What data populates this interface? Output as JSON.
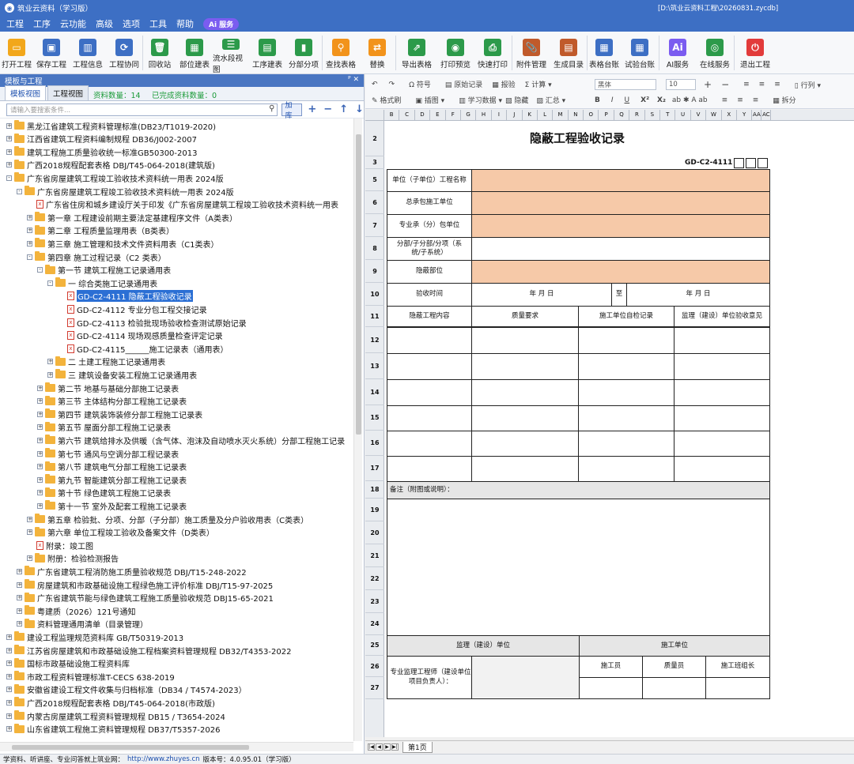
{
  "window": {
    "title": "筑业云资料（学习版）",
    "path": "[D:\\筑业云资料工程\\20260831.zycdb]"
  },
  "menu": {
    "items": [
      "工程",
      "工序",
      "云功能",
      "高级",
      "选项",
      "工具",
      "帮助"
    ],
    "ai_badge": "Ai 服务"
  },
  "toolbar": [
    {
      "label": "打开工程",
      "icon": "folder-open-icon",
      "color": "#f2a71b"
    },
    {
      "label": "保存工程",
      "icon": "save-icon",
      "color": "#3d6fc4"
    },
    {
      "label": "工程信息",
      "icon": "building-info-icon",
      "color": "#3d6fc4"
    },
    {
      "label": "工程协同",
      "icon": "sync-icon",
      "color": "#3d6fc4"
    },
    {
      "label": "回收站",
      "icon": "recycle-bin-icon",
      "color": "#2c9a4a"
    },
    {
      "label": "部位建表",
      "icon": "table-part-icon",
      "color": "#2c9a4a"
    },
    {
      "label": "流水段视图",
      "icon": "flow-view-icon",
      "color": "#2c9a4a"
    },
    {
      "label": "工序建表",
      "icon": "process-table-icon",
      "color": "#2c9a4a"
    },
    {
      "label": "分部分项",
      "icon": "chart-icon",
      "color": "#2c9a4a"
    },
    {
      "label": "查找表格",
      "icon": "search-icon",
      "color": "#f2931b"
    },
    {
      "label": "替换",
      "icon": "replace-icon",
      "color": "#f2931b"
    },
    {
      "label": "导出表格",
      "icon": "export-icon",
      "color": "#2c9a4a"
    },
    {
      "label": "打印预览",
      "icon": "eye-icon",
      "color": "#2c9a4a"
    },
    {
      "label": "快速打印",
      "icon": "printer-icon",
      "color": "#2c9a4a"
    },
    {
      "label": "附件管理",
      "icon": "attachment-icon",
      "color": "#c05a2b"
    },
    {
      "label": "生成目录",
      "icon": "catalog-icon",
      "color": "#c05a2b"
    },
    {
      "label": "表格台账",
      "icon": "ledger-icon",
      "color": "#3d6fc4"
    },
    {
      "label": "试验台账",
      "icon": "test-ledger-icon",
      "color": "#3d6fc4"
    },
    {
      "label": "AI服务",
      "icon": "ai-icon",
      "color": "#7b5cf0"
    },
    {
      "label": "在线服务",
      "icon": "online-service-icon",
      "color": "#2c9a4a"
    },
    {
      "label": "退出工程",
      "icon": "power-icon",
      "color": "#e23b3b"
    }
  ],
  "left_panel": {
    "title": "模板与工程",
    "tabs": [
      "模板视图",
      "工程视图"
    ],
    "stats": {
      "count_label": "资料数量：14",
      "done_label": "已完成资料数量：0"
    },
    "search": {
      "placeholder": "请输入要搜索条件...",
      "button": "加库"
    },
    "tree": [
      {
        "d": 0,
        "t": "f",
        "e": "+",
        "x": "黑龙江省建筑工程资料管理标准(DB23/T1019-2020)"
      },
      {
        "d": 0,
        "t": "f",
        "e": "+",
        "x": "江西省建筑工程资料编制规程 DB36/J002-2007"
      },
      {
        "d": 0,
        "t": "f",
        "e": "+",
        "x": "建筑工程施工质量验收统一标准GB50300-2013"
      },
      {
        "d": 0,
        "t": "f",
        "e": "+",
        "x": "广西2018规程配套表格 DBJ/T45-064-2018(建筑版)"
      },
      {
        "d": 0,
        "t": "f",
        "e": "-",
        "x": "广东省房屋建筑工程竣工验收技术资料统一用表 2024版"
      },
      {
        "d": 1,
        "t": "f",
        "e": "-",
        "x": "广东省房屋建筑工程竣工验收技术资料统一用表 2024版"
      },
      {
        "d": 2,
        "t": "d",
        "e": "",
        "x": "广东省住房和城乡建设厅关于印发《广东省房屋建筑工程竣工验收技术资料统一用表"
      },
      {
        "d": 2,
        "t": "f",
        "e": "+",
        "x": "第一章 工程建设前期主要法定基建程序文件（A类表）"
      },
      {
        "d": 2,
        "t": "f",
        "e": "+",
        "x": "第二章 工程质量监理用表（B类表）"
      },
      {
        "d": 2,
        "t": "f",
        "e": "+",
        "x": "第三章 施工管理和技术文件资料用表（C1类表）"
      },
      {
        "d": 2,
        "t": "f",
        "e": "-",
        "x": "第四章 施工过程记录（C2 类表）"
      },
      {
        "d": 3,
        "t": "f",
        "e": "-",
        "x": "第一节 建筑工程施工记录通用表"
      },
      {
        "d": 4,
        "t": "f",
        "e": "-",
        "x": "一 综合类施工记录通用表"
      },
      {
        "d": 5,
        "t": "d",
        "e": "",
        "x": "GD-C2-4111 隐蔽工程验收记录",
        "sel": true
      },
      {
        "d": 5,
        "t": "d",
        "e": "",
        "x": "GD-C2-4112 专业分包工程交接记录"
      },
      {
        "d": 5,
        "t": "d",
        "e": "",
        "x": "GD-C2-4113 检验批现场验收检查测试原始记录"
      },
      {
        "d": 5,
        "t": "d",
        "e": "",
        "x": "GD-C2-4114 现场观感质量检查评定记录"
      },
      {
        "d": 5,
        "t": "d",
        "e": "",
        "x": "GD-C2-4115______施工记录表（通用表）"
      },
      {
        "d": 4,
        "t": "f",
        "e": "+",
        "x": "二 土建工程施工记录通用表"
      },
      {
        "d": 4,
        "t": "f",
        "e": "+",
        "x": "三 建筑设备安装工程施工记录通用表"
      },
      {
        "d": 3,
        "t": "f",
        "e": "+",
        "x": "第二节 地基与基础分部施工记录表"
      },
      {
        "d": 3,
        "t": "f",
        "e": "+",
        "x": "第三节 主体结构分部工程施工记录表"
      },
      {
        "d": 3,
        "t": "f",
        "e": "+",
        "x": "第四节 建筑装饰装修分部工程施工记录表"
      },
      {
        "d": 3,
        "t": "f",
        "e": "+",
        "x": "第五节 屋面分部工程施工记录表"
      },
      {
        "d": 3,
        "t": "f",
        "e": "+",
        "x": "第六节 建筑给排水及供暖（含气体、泡沫及自动喷水灭火系统）分部工程施工记录"
      },
      {
        "d": 3,
        "t": "f",
        "e": "+",
        "x": "第七节 通风与空调分部工程记录表"
      },
      {
        "d": 3,
        "t": "f",
        "e": "+",
        "x": "第八节 建筑电气分部工程施工记录表"
      },
      {
        "d": 3,
        "t": "f",
        "e": "+",
        "x": "第九节 智能建筑分部工程施工记录表"
      },
      {
        "d": 3,
        "t": "f",
        "e": "+",
        "x": "第十节 绿色建筑工程施工记录表"
      },
      {
        "d": 3,
        "t": "f",
        "e": "+",
        "x": "第十一节 室外及配套工程施工记录表"
      },
      {
        "d": 2,
        "t": "f",
        "e": "+",
        "x": "第五章 检验批、分项、分部（子分部）施工质量及分户验收用表（C类表）"
      },
      {
        "d": 2,
        "t": "f",
        "e": "+",
        "x": "第六章 单位工程竣工验收及备案文件（D类表）"
      },
      {
        "d": 2,
        "t": "d",
        "e": "",
        "x": "附录：竣工图"
      },
      {
        "d": 2,
        "t": "f",
        "e": "+",
        "x": "附册：检验检测报告"
      },
      {
        "d": 1,
        "t": "f",
        "e": "+",
        "x": "广东省建筑工程消防施工质量验收规范 DBJ/T15-248-2022"
      },
      {
        "d": 1,
        "t": "f",
        "e": "+",
        "x": "房屋建筑和市政基础设施工程绿色施工评价标准 DBJ/T15-97-2025"
      },
      {
        "d": 1,
        "t": "f",
        "e": "+",
        "x": "广东省建筑节能与绿色建筑工程施工质量验收规范 DBJ15-65-2021"
      },
      {
        "d": 1,
        "t": "f",
        "e": "+",
        "x": "粤建质（2026）121号通知"
      },
      {
        "d": 1,
        "t": "f",
        "e": "+",
        "x": "资料管理通用清单（目录管理）"
      },
      {
        "d": 0,
        "t": "f",
        "e": "+",
        "x": "建设工程监理规范资料库 GB/T50319-2013"
      },
      {
        "d": 0,
        "t": "f",
        "e": "+",
        "x": "江苏省房屋建筑和市政基础设施工程档案资料管理规程 DB32/T4353-2022"
      },
      {
        "d": 0,
        "t": "f",
        "e": "+",
        "x": "国标市政基础设施工程资料库"
      },
      {
        "d": 0,
        "t": "f",
        "e": "+",
        "x": "市政工程资料管理标准T-CECS 638-2019"
      },
      {
        "d": 0,
        "t": "f",
        "e": "+",
        "x": "安徽省建设工程文件收集与归档标准（DB34 / T4574-2023）"
      },
      {
        "d": 0,
        "t": "f",
        "e": "+",
        "x": "广西2018规程配套表格 DBJ/T45-064-2018(市政版)"
      },
      {
        "d": 0,
        "t": "f",
        "e": "+",
        "x": "内蒙古房屋建筑工程资料管理规程 DB15 / T3654-2024"
      },
      {
        "d": 0,
        "t": "f",
        "e": "+",
        "x": "山东省建筑工程施工资料管理规程 DB37/T5357-2026"
      }
    ]
  },
  "ribbon": {
    "undo": "↶",
    "redo": "↷",
    "symbol": "符号",
    "format_brush": "格式刷",
    "add_record": "原始记录",
    "report": "报验",
    "calc": "计算",
    "insert_image": "插图",
    "learn_data": "学习数据",
    "hide": "隐藏",
    "summary": "汇总",
    "font": "黑体",
    "size": "10",
    "row": "行列",
    "split": "拆分"
  },
  "columns": [
    "B",
    "C",
    "D",
    "E",
    "F",
    "G",
    "H",
    "I",
    "J",
    "K",
    "L",
    "M",
    "N",
    "O",
    "P",
    "Q",
    "R",
    "S",
    "T",
    "U",
    "V",
    "W",
    "X",
    "Y",
    "AA",
    "AC"
  ],
  "form": {
    "rows": [
      "2",
      "3",
      "5",
      "6",
      "7",
      "8",
      "9",
      "10",
      "11",
      "12",
      "13",
      "14",
      "15",
      "16",
      "17",
      "18",
      "19",
      "20",
      "21",
      "22",
      "23",
      "24",
      "25",
      "26",
      "27"
    ],
    "title": "隐蔽工程验收记录",
    "code": "GD-C2-4111",
    "project_name": "单位（子单位）工程名称",
    "general_contractor": "总承包施工单位",
    "sub_contractor": "专业承（分）包单位",
    "division": "分部/子分部/分项（系统/子系统）",
    "hidden_location": "隐蔽部位",
    "accept_time": "验收时间",
    "date_from": "年    月    日",
    "to": "至",
    "date_to": "年    月    日",
    "col_content": "隐蔽工程内容",
    "col_quality": "质量要求",
    "col_self_check": "施工单位自检记录",
    "col_supervisor": "监理（建设）单位验收意见",
    "remark": "备注（附图或说明）：",
    "supervisor_unit": "监理（建设）单位",
    "construction_unit": "施工单位",
    "supervisor_engineer": "专业监理工程师（建设单位项目负责人）：",
    "worker": "施工员",
    "quality_officer": "质量员",
    "team_leader": "施工班组长"
  },
  "sheet_tab": "第1页",
  "status": {
    "prefix": "学资料、听讲座、专业问答就上筑业网：",
    "url": "http://www.zhuyes.cn",
    "version": "版本号：4.0.95.01（学习版）"
  }
}
